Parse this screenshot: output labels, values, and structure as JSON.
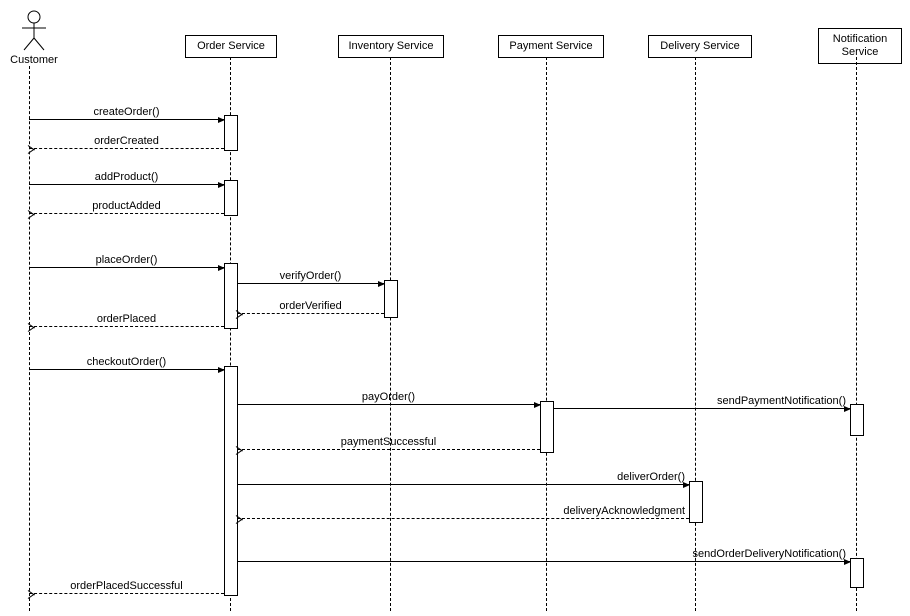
{
  "participants": {
    "customer": "Customer",
    "order_service": "Order Service",
    "inventory_service": "Inventory Service",
    "payment_service": "Payment Service",
    "delivery_service": "Delivery Service",
    "notification_service": "Notification Service"
  },
  "messages": {
    "m1": "createOrder()",
    "r1": "orderCreated",
    "m2": "addProduct()",
    "r2": "productAdded",
    "m3": "placeOrder()",
    "m3a": "verifyOrder()",
    "r3a": "orderVerified",
    "r3": "orderPlaced",
    "m4": "checkoutOrder()",
    "m5": "payOrder()",
    "m5a": "sendPaymentNotification()",
    "r5": "paymentSuccessful",
    "m6": "deliverOrder()",
    "r6": "deliveryAcknowledgment",
    "m7": "sendOrderDeliveryNotification()",
    "r4": "orderPlacedSuccessful"
  },
  "chart_data": {
    "type": "sequence-diagram",
    "participants": [
      "Customer",
      "Order Service",
      "Inventory Service",
      "Payment Service",
      "Delivery Service",
      "Notification Service"
    ],
    "interactions": [
      {
        "from": "Customer",
        "to": "Order Service",
        "label": "createOrder()",
        "style": "sync"
      },
      {
        "from": "Order Service",
        "to": "Customer",
        "label": "orderCreated",
        "style": "return"
      },
      {
        "from": "Customer",
        "to": "Order Service",
        "label": "addProduct()",
        "style": "sync"
      },
      {
        "from": "Order Service",
        "to": "Customer",
        "label": "productAdded",
        "style": "return"
      },
      {
        "from": "Customer",
        "to": "Order Service",
        "label": "placeOrder()",
        "style": "sync"
      },
      {
        "from": "Order Service",
        "to": "Inventory Service",
        "label": "verifyOrder()",
        "style": "sync"
      },
      {
        "from": "Inventory Service",
        "to": "Order Service",
        "label": "orderVerified",
        "style": "return"
      },
      {
        "from": "Order Service",
        "to": "Customer",
        "label": "orderPlaced",
        "style": "return"
      },
      {
        "from": "Customer",
        "to": "Order Service",
        "label": "checkoutOrder()",
        "style": "sync"
      },
      {
        "from": "Order Service",
        "to": "Payment Service",
        "label": "payOrder()",
        "style": "sync"
      },
      {
        "from": "Payment Service",
        "to": "Notification Service",
        "label": "sendPaymentNotification()",
        "style": "sync"
      },
      {
        "from": "Payment Service",
        "to": "Order Service",
        "label": "paymentSuccessful",
        "style": "return"
      },
      {
        "from": "Order Service",
        "to": "Delivery Service",
        "label": "deliverOrder()",
        "style": "sync"
      },
      {
        "from": "Delivery Service",
        "to": "Order Service",
        "label": "deliveryAcknowledgment",
        "style": "return"
      },
      {
        "from": "Order Service",
        "to": "Notification Service",
        "label": "sendOrderDeliveryNotification()",
        "style": "sync"
      },
      {
        "from": "Order Service",
        "to": "Customer",
        "label": "orderPlacedSuccessful",
        "style": "return"
      }
    ]
  }
}
